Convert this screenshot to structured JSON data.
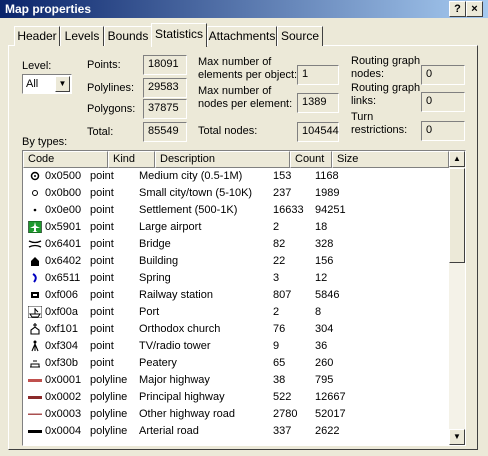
{
  "window": {
    "title": "Map properties",
    "help_label": "?",
    "close_label": "×"
  },
  "tabs": [
    {
      "label": "Header"
    },
    {
      "label": "Levels"
    },
    {
      "label": "Bounds"
    },
    {
      "label": "Statistics"
    },
    {
      "label": "Attachments"
    },
    {
      "label": "Source"
    }
  ],
  "active_tab": "Statistics",
  "level": {
    "label": "Level:",
    "value": "All"
  },
  "counts": {
    "points_label": "Points:",
    "points": "18091",
    "polylines_label": "Polylines:",
    "polylines": "29583",
    "polygons_label": "Polygons:",
    "polygons": "37875",
    "total_label": "Total:",
    "total": "85549"
  },
  "limits": {
    "max_elements_label_1": "Max number of",
    "max_elements_label_2": "elements per object:",
    "max_elements": "1",
    "max_nodes_label_1": "Max number of",
    "max_nodes_label_2": "nodes per element:",
    "max_nodes": "1389",
    "total_nodes_label": "Total nodes:",
    "total_nodes": "104544"
  },
  "routing": {
    "graph_nodes_label_1": "Routing graph",
    "graph_nodes_label_2": "nodes:",
    "graph_nodes": "0",
    "graph_links_label_1": "Routing graph",
    "graph_links_label_2": "links:",
    "graph_links": "0",
    "turn_label_1": "Turn",
    "turn_label_2": "restrictions:",
    "turn": "0"
  },
  "by_types_label": "By types:",
  "columns": [
    "Code",
    "Kind",
    "Description",
    "Count",
    "Size"
  ],
  "rows": [
    {
      "icon": "medium-city-icon",
      "code": "0x0500",
      "kind": "point",
      "desc": "Medium city (0.5-1M)",
      "count": "153",
      "size": "1168"
    },
    {
      "icon": "small-city-icon",
      "code": "0x0b00",
      "kind": "point",
      "desc": "Small city/town (5-10K)",
      "count": "237",
      "size": "1989"
    },
    {
      "icon": "settlement-icon",
      "code": "0x0e00",
      "kind": "point",
      "desc": "Settlement (500-1K)",
      "count": "16633",
      "size": "94251"
    },
    {
      "icon": "airport-icon",
      "code": "0x5901",
      "kind": "point",
      "desc": "Large airport",
      "count": "2",
      "size": "18"
    },
    {
      "icon": "bridge-icon",
      "code": "0x6401",
      "kind": "point",
      "desc": "Bridge",
      "count": "82",
      "size": "328"
    },
    {
      "icon": "building-icon",
      "code": "0x6402",
      "kind": "point",
      "desc": "Building",
      "count": "22",
      "size": "156"
    },
    {
      "icon": "spring-icon",
      "code": "0x6511",
      "kind": "point",
      "desc": "Spring",
      "count": "3",
      "size": "12"
    },
    {
      "icon": "railway-station-icon",
      "code": "0xf006",
      "kind": "point",
      "desc": "Railway station",
      "count": "807",
      "size": "5846"
    },
    {
      "icon": "port-icon",
      "code": "0xf00a",
      "kind": "point",
      "desc": "Port",
      "count": "2",
      "size": "8"
    },
    {
      "icon": "church-icon",
      "code": "0xf101",
      "kind": "point",
      "desc": "Orthodox church",
      "count": "76",
      "size": "304"
    },
    {
      "icon": "tower-icon",
      "code": "0xf304",
      "kind": "point",
      "desc": "TV/radio tower",
      "count": "9",
      "size": "36"
    },
    {
      "icon": "peatery-icon",
      "code": "0xf30b",
      "kind": "point",
      "desc": "Peatery",
      "count": "65",
      "size": "260"
    },
    {
      "icon": "major-highway-line-icon",
      "code": "0x0001",
      "kind": "polyline",
      "desc": "Major highway",
      "count": "38",
      "size": "795"
    },
    {
      "icon": "principal-highway-line-icon",
      "code": "0x0002",
      "kind": "polyline",
      "desc": "Principal highway",
      "count": "522",
      "size": "12667"
    },
    {
      "icon": "other-highway-line-icon",
      "code": "0x0003",
      "kind": "polyline",
      "desc": "Other highway road",
      "count": "2780",
      "size": "52017"
    },
    {
      "icon": "arterial-road-line-icon",
      "code": "0x0004",
      "kind": "polyline",
      "desc": "Arterial road",
      "count": "337",
      "size": "2622"
    }
  ]
}
